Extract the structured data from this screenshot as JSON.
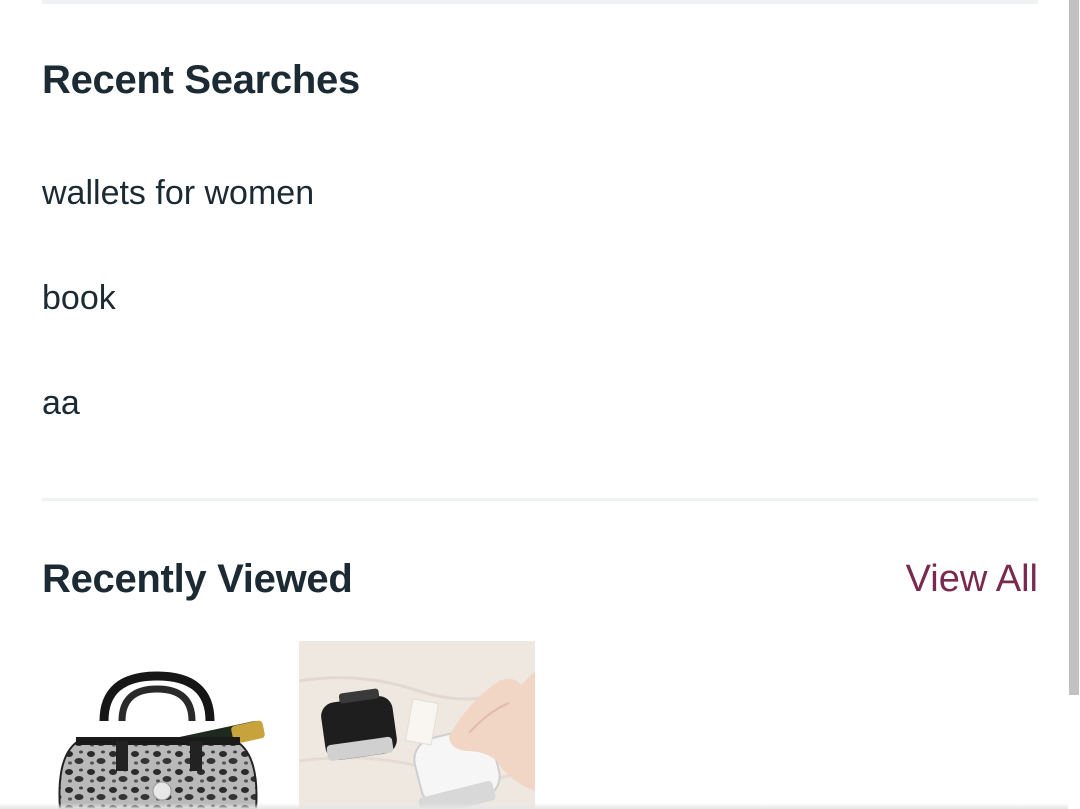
{
  "recent_searches": {
    "title": "Recent Searches",
    "items": [
      "wallets for women",
      "book",
      "aa"
    ]
  },
  "recently_viewed": {
    "title": "Recently Viewed",
    "view_all_label": "View All",
    "products": [
      {
        "image": "leopard-print-handbag-with-wine-bottle"
      },
      {
        "image": "lint-remover-fabric-shaver"
      }
    ]
  },
  "colors": {
    "heading": "#1c2a33",
    "link": "#7a2a4e",
    "divider": "#eef2f2"
  }
}
